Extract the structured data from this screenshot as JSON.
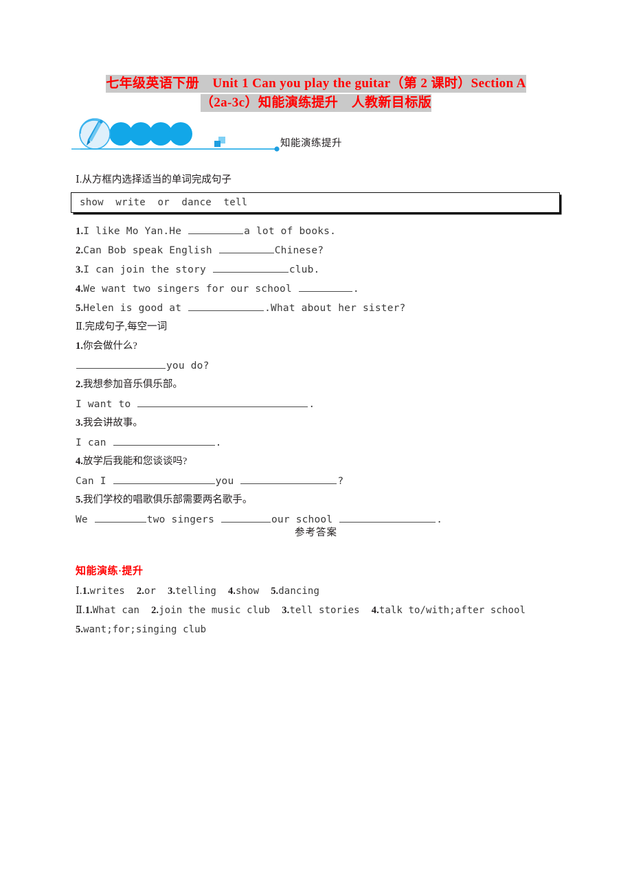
{
  "document": {
    "title_line_1": "七年级英语下册　Unit 1 Can you play the guitar（第 2 课时）Section A",
    "title_line_2": "（2a-3c）知能演练提升　人教新目标版",
    "title_color": "#ff0000",
    "highlight_color": "#c9c9c9"
  },
  "banner": {
    "label": "知能演练提升",
    "accent_color": "#12a7e8",
    "circle_fill": "#d8eefb",
    "icon": "pen-brush-icon"
  },
  "section_1": {
    "heading": "Ⅰ.从方框内选择适当的单词完成句子",
    "wordbox": "show  write  or  dance  tell",
    "questions": [
      {
        "num": "1.",
        "before": "I like Mo Yan.He ",
        "blank": 80,
        "after": "a lot of books."
      },
      {
        "num": "2.",
        "before": "Can Bob speak English ",
        "blank": 80,
        "after": "Chinese?"
      },
      {
        "num": "3.",
        "before": "I can join the story ",
        "blank": 110,
        "after": "club."
      },
      {
        "num": "4.",
        "before": "We want two singers for our school ",
        "blank": 78,
        "after": "."
      },
      {
        "num": "5.",
        "before": "Helen is good at ",
        "blank": 110,
        "after": ".What about her sister?"
      }
    ]
  },
  "section_2": {
    "heading": "Ⅱ.完成句子,每空一词",
    "items": [
      {
        "num": "1.",
        "chinese": "你会做什么?",
        "answer_before": "",
        "blank1": 130,
        "answer_mid": "you do?",
        "blank2": 0,
        "answer_after": ""
      },
      {
        "num": "2.",
        "chinese": "我想参加音乐俱乐部。",
        "answer_before": "I want to ",
        "blank1": 248,
        "answer_mid": ".",
        "blank2": 0,
        "answer_after": ""
      },
      {
        "num": "3.",
        "chinese": "我会讲故事。",
        "answer_before": "I can ",
        "blank1": 148,
        "answer_mid": ".",
        "blank2": 0,
        "answer_after": ""
      },
      {
        "num": "4.",
        "chinese": "放学后我能和您谈谈吗?",
        "answer_before": "Can I ",
        "blank1": 148,
        "answer_mid": "you ",
        "blank2": 140,
        "answer_after": "?"
      },
      {
        "num": "5.",
        "chinese": "我们学校的唱歌俱乐部需要两名歌手。",
        "answer_before": "We ",
        "blank1": 75,
        "answer_mid": "two singers ",
        "blank2": 72,
        "answer_after": "our school ",
        "blank3": 140,
        "answer_end": "."
      }
    ]
  },
  "answers": {
    "title": "参考答案",
    "heading": "知能演练·提升",
    "lines": [
      {
        "roman": "Ⅰ.",
        "entries": [
          {
            "num": "1.",
            "text": "writes"
          },
          {
            "num": "2.",
            "text": "or"
          },
          {
            "num": "3.",
            "text": "telling"
          },
          {
            "num": "4.",
            "text": "show"
          },
          {
            "num": "5.",
            "text": "dancing"
          }
        ]
      },
      {
        "roman": "Ⅱ.",
        "entries": [
          {
            "num": "1.",
            "text": "What can"
          },
          {
            "num": "2.",
            "text": "join the music club"
          },
          {
            "num": "3.",
            "text": "tell stories"
          },
          {
            "num": "4.",
            "text": "talk to/with;after school"
          }
        ]
      },
      {
        "roman": "",
        "entries": [
          {
            "num": "5.",
            "text": "want;for;singing club"
          }
        ]
      }
    ]
  }
}
